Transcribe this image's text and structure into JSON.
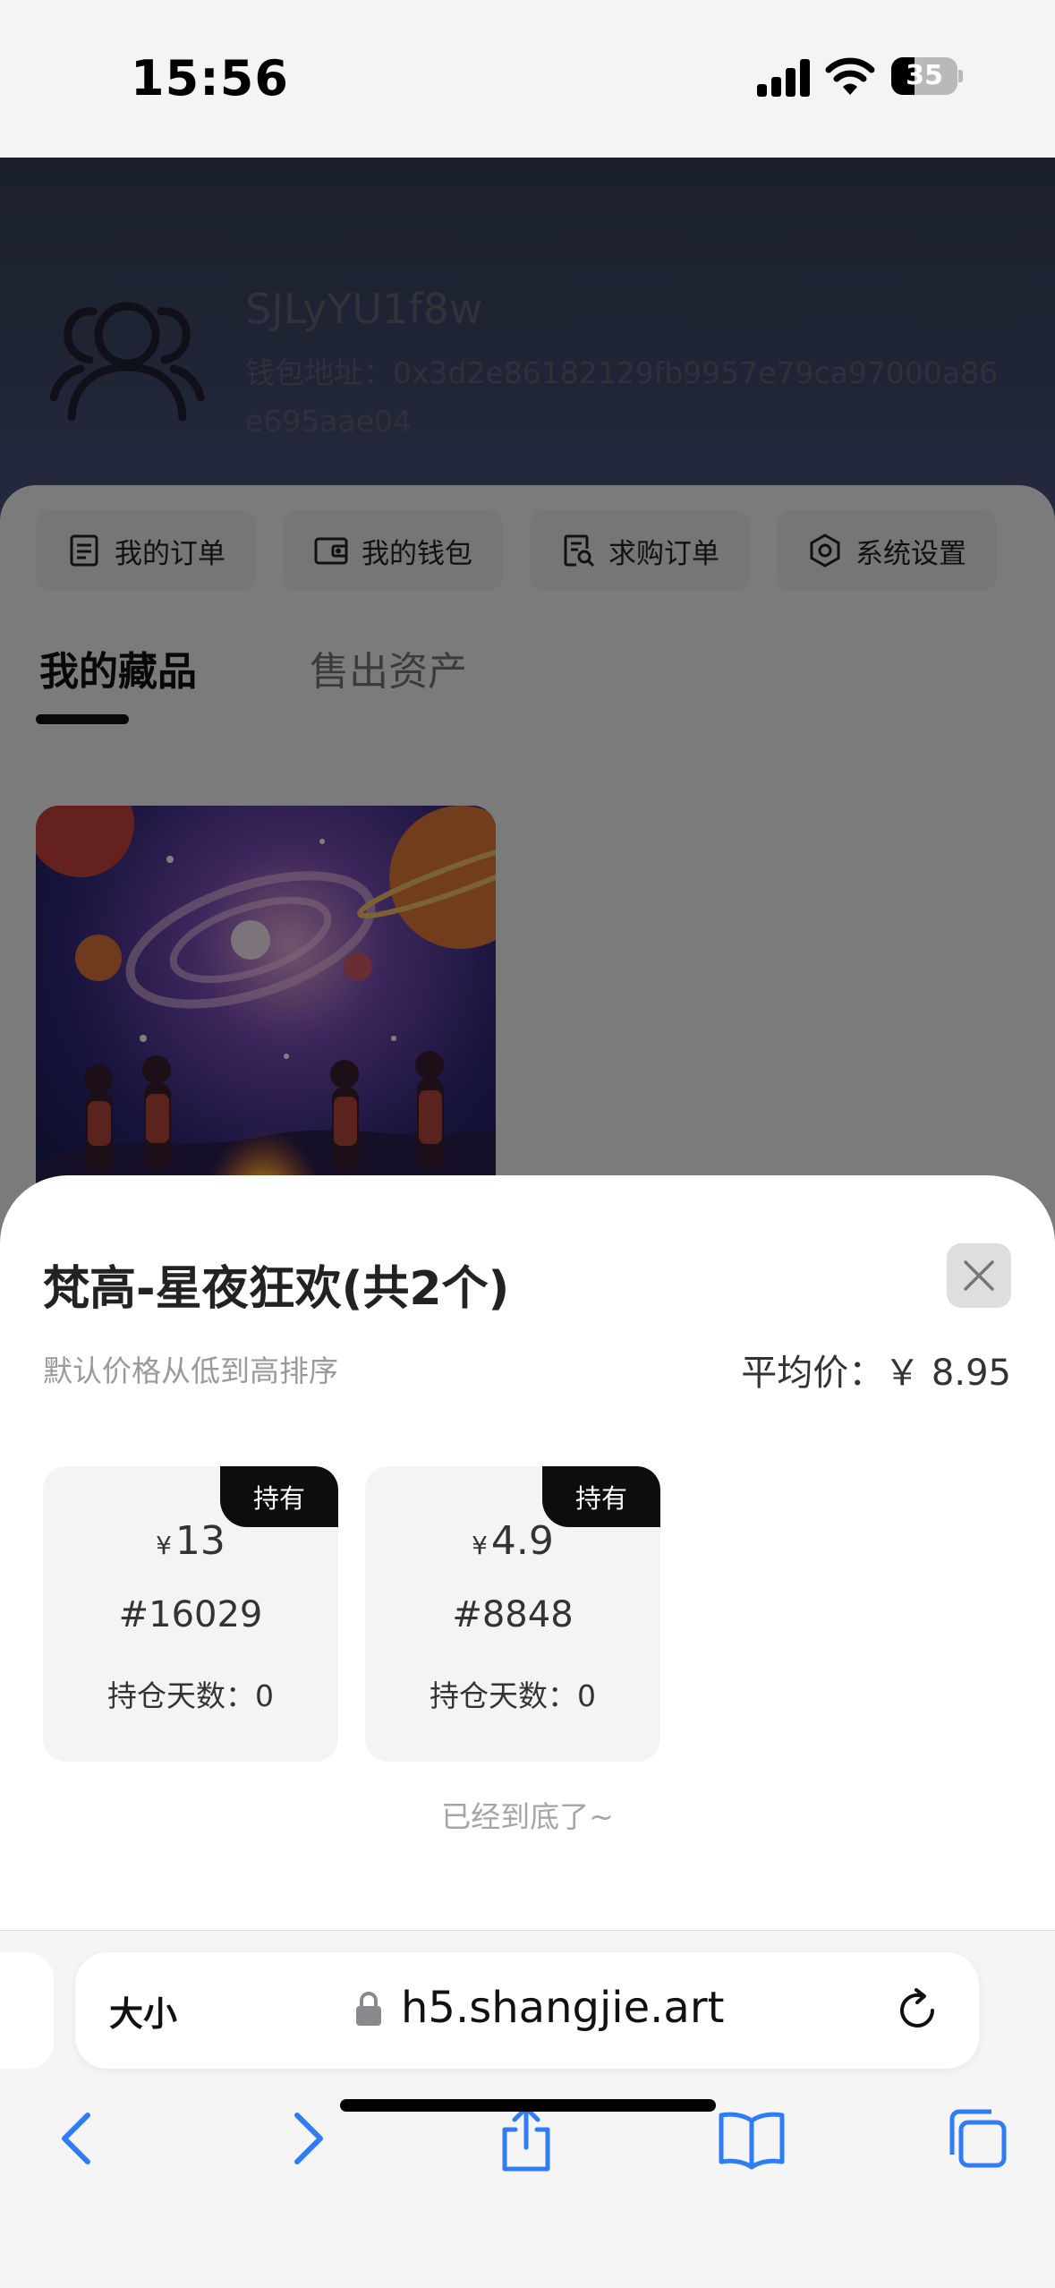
{
  "status_bar": {
    "time": "15:56",
    "battery": "35",
    "battery_level_percent": 35
  },
  "profile": {
    "username": "SJLyYU1f8w",
    "wallet_address": "钱包地址：0x3d2e86182129fb9957e79ca97000a86e695aae04"
  },
  "menu": [
    {
      "label": "我的订单",
      "icon": "order-list-icon"
    },
    {
      "label": "我的钱包",
      "icon": "wallet-icon"
    },
    {
      "label": "求购订单",
      "icon": "purchase-order-icon"
    },
    {
      "label": "系统设置",
      "icon": "settings-hexagon-icon"
    }
  ],
  "tabs": {
    "active": "我的藏品",
    "inactive": "售出资产"
  },
  "sheet": {
    "title": "梵高-星夜狂欢(共2个)",
    "sort_hint": "默认价格从低到高排序",
    "avg_price": "平均价：￥ 8.95",
    "items": [
      {
        "badge": "持有",
        "currency": "¥",
        "price": "13",
        "number": "#16029",
        "days": "持仓天数：0"
      },
      {
        "badge": "持有",
        "currency": "¥",
        "price": "4.9",
        "number": "#8848",
        "days": "持仓天数：0"
      }
    ],
    "end_text": "已经到底了~"
  },
  "browser": {
    "text_size_label": "大小",
    "url": "h5.shangjie.art",
    "accent_color": "#2f7cf6"
  }
}
